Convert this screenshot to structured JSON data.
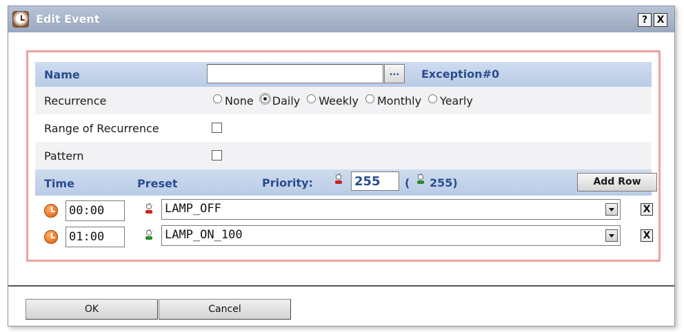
{
  "dialog": {
    "title": "Edit Event",
    "help_label": "?",
    "close_label": "X"
  },
  "form": {
    "name_label": "Name",
    "name_value": "",
    "browse_label": "...",
    "exception_label": "Exception#0",
    "recurrence_label": "Recurrence",
    "recurrence_options": [
      "None",
      "Daily",
      "Weekly",
      "Monthly",
      "Yearly"
    ],
    "recurrence_selected": "Daily",
    "range_label": "Range of Recurrence",
    "range_checked": false,
    "pattern_label": "Pattern",
    "pattern_checked": false
  },
  "schedule": {
    "time_header": "Time",
    "preset_header": "Preset",
    "priority_label": "Priority:",
    "priority_value": "255",
    "priority_paren_open": "(",
    "priority_current": "255)",
    "add_row_label": "Add Row",
    "rows": [
      {
        "time": "00:00",
        "preset": "LAMP_OFF",
        "lamp_color": "#cc2222",
        "delete_label": "X"
      },
      {
        "time": "01:00",
        "preset": "LAMP_ON_100",
        "lamp_color": "#2a8a2a",
        "delete_label": "X"
      }
    ]
  },
  "footer": {
    "ok_label": "OK",
    "cancel_label": "Cancel"
  },
  "colors": {
    "frame_border": "#f0a0a0",
    "header_text": "#2a4d8f",
    "title_bar": "#9aa8bf"
  }
}
